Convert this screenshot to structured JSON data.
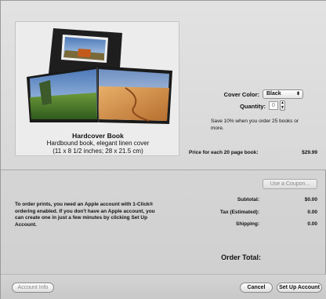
{
  "preview": {
    "title": "Hardcover Book",
    "subtitle": "Hardbound book, elegant linen cover",
    "dimensions": "(11 x 8 1/2 inches; 28 x 21.5 cm)"
  },
  "options": {
    "cover_color_label": "Cover Color:",
    "cover_color_value": "Black",
    "quantity_label": "Quantity:",
    "quantity_value": "0",
    "discount_note": "Save 10% when you order 25 books or more.",
    "price_label": "Price for each 20 page book:",
    "price_value": "$29.99"
  },
  "coupon": {
    "label": "Use a Coupon..."
  },
  "account_info_text": "To order prints, you need an Apple account with 1-Click® ordering enabled. If you don't have an Apple account, you can create one in just a few minutes by clicking Set Up Account.",
  "totals": {
    "subtotal_label": "Subtotal:",
    "subtotal_value": "$0.00",
    "tax_label": "Tax (Estimated):",
    "tax_value": "0.00",
    "shipping_label": "Shipping:",
    "shipping_value": "0.00",
    "order_total_label": "Order Total:"
  },
  "buttons": {
    "account_info": "Account Info",
    "cancel": "Cancel",
    "set_up_account": "Set Up Account"
  },
  "icons": {
    "popup_arrows": "updown-arrows-icon",
    "stepper": "stepper-icon"
  },
  "colors": {
    "window_bg": "#d6d6d6",
    "book_cover": "#1e1e1e"
  }
}
